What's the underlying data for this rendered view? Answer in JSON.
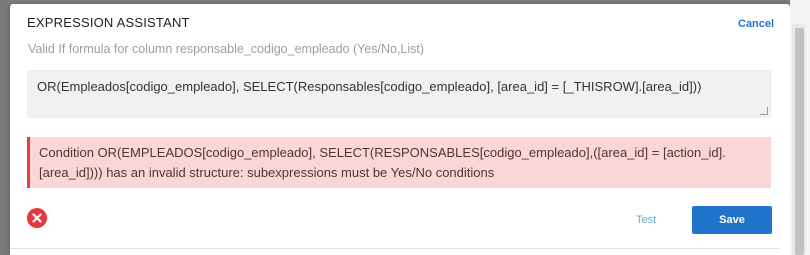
{
  "dialog": {
    "title": "EXPRESSION ASSISTANT",
    "cancel_label": "Cancel",
    "subtitle": "Valid If formula for column responsable_codigo_empleado (Yes/No,List)"
  },
  "formula": {
    "value": "OR(Empleados[codigo_empleado], SELECT(Responsables[codigo_empleado], [area_id] = [_THISROW].[area_id]))"
  },
  "error": {
    "message": "Condition OR(EMPLEADOS[codigo_empleado], SELECT(RESPONSABLES[codigo_empleado],([area_id] = [action_id].[area_id]))) has an invalid structure: subexpressions must be Yes/No conditions"
  },
  "footer": {
    "error_icon": "close-circle-icon",
    "test_label": "Test",
    "save_label": "Save"
  },
  "colors": {
    "accent": "#1f74c9",
    "error_bg": "#f9d7d6",
    "error_border": "#e04040",
    "error_icon": "#e5393c"
  }
}
